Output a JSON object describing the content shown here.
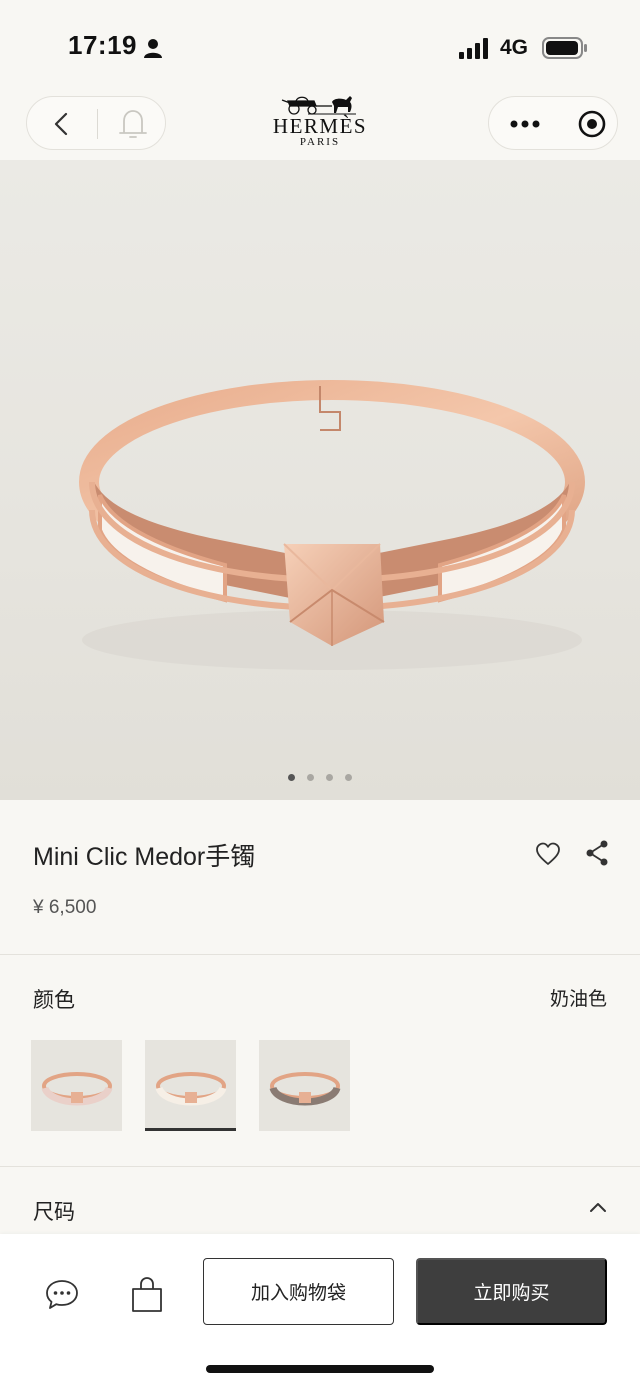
{
  "status_bar": {
    "time": "17:19",
    "network": "4G",
    "icons": [
      "person-icon",
      "signal-icon",
      "battery-icon"
    ]
  },
  "nav": {
    "left_icons": [
      "back-arrow-icon",
      "bell-icon"
    ],
    "right_icons": [
      "more-icon",
      "record-icon"
    ]
  },
  "brand": {
    "name": "HERMÈS",
    "city": "PARIS"
  },
  "gallery": {
    "image_count": 4,
    "active_index": 0
  },
  "product": {
    "title": "Mini Clic Medor手镯",
    "price": "¥ 6,500"
  },
  "color": {
    "label": "颜色",
    "selected": "奶油色",
    "swatches": [
      {
        "enamel": "#ead0c9",
        "selected": false
      },
      {
        "enamel": "#f6efe6",
        "selected": true
      },
      {
        "enamel": "#8a7b73",
        "selected": false
      }
    ]
  },
  "size": {
    "label": "尺码"
  },
  "actions": {
    "add_to_bag": "加入购物袋",
    "buy_now": "立即购买"
  },
  "colors": {
    "background": "#f8f7f3",
    "image_bg": "#e6e4de",
    "buy_button": "#3e3e3e",
    "rose_gold": "#e2a485"
  }
}
